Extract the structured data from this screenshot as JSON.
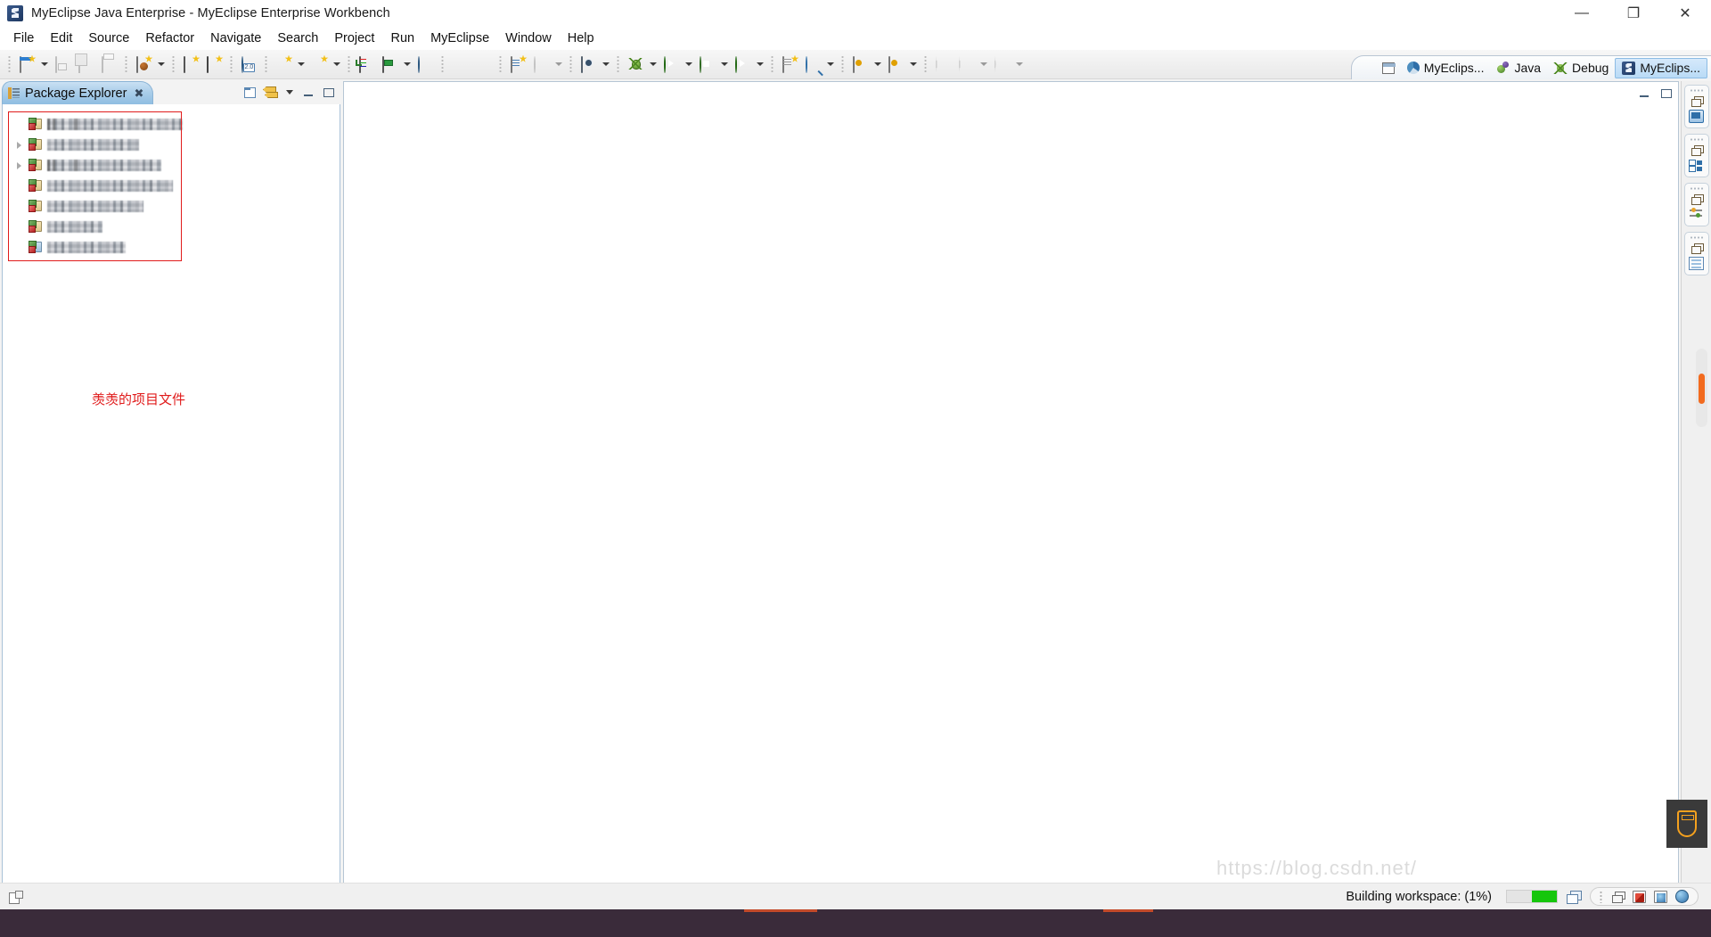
{
  "window": {
    "title": "MyEclipse Java Enterprise - MyEclipse Enterprise Workbench",
    "app_icon": "myeclipse-logo-icon",
    "minimize_label": "—",
    "maximize_label": "❐",
    "close_label": "✕"
  },
  "menubar": {
    "items": [
      {
        "label": "File",
        "name": "menu-file"
      },
      {
        "label": "Edit",
        "name": "menu-edit"
      },
      {
        "label": "Source",
        "name": "menu-source"
      },
      {
        "label": "Refactor",
        "name": "menu-refactor"
      },
      {
        "label": "Navigate",
        "name": "menu-navigate"
      },
      {
        "label": "Search",
        "name": "menu-search"
      },
      {
        "label": "Project",
        "name": "menu-project"
      },
      {
        "label": "Run",
        "name": "menu-run"
      },
      {
        "label": "MyEclipse",
        "name": "menu-myeclipse"
      },
      {
        "label": "Window",
        "name": "menu-window"
      },
      {
        "label": "Help",
        "name": "menu-help"
      }
    ]
  },
  "toolbar": {
    "groups": [
      {
        "name": "file-group",
        "buttons": [
          {
            "icon": "new-wizard-icon",
            "dropdown": true,
            "enabled": true
          },
          {
            "icon": "save-icon",
            "dropdown": false,
            "enabled": false
          },
          {
            "icon": "save-all-icon",
            "dropdown": false,
            "enabled": false
          },
          {
            "icon": "print-icon",
            "dropdown": false,
            "enabled": false
          }
        ]
      },
      {
        "name": "java-group",
        "buttons": [
          {
            "icon": "new-java-class-icon",
            "dropdown": true,
            "enabled": true
          }
        ]
      },
      {
        "name": "package-group",
        "buttons": [
          {
            "icon": "open-type-icon",
            "dropdown": false,
            "enabled": true
          },
          {
            "icon": "open-package-icon",
            "dropdown": false,
            "enabled": true
          }
        ]
      },
      {
        "name": "web-group",
        "buttons": [
          {
            "icon": "web-20-icon",
            "dropdown": false,
            "enabled": true
          }
        ]
      },
      {
        "name": "deploy-group",
        "buttons": [
          {
            "icon": "deploy-icon",
            "dropdown": true,
            "enabled": true
          },
          {
            "icon": "web-deploy-icon",
            "dropdown": true,
            "enabled": true
          }
        ]
      },
      {
        "name": "server-group",
        "buttons": [
          {
            "icon": "db-explorer-icon",
            "dropdown": false,
            "enabled": true
          },
          {
            "icon": "server-icon",
            "dropdown": true,
            "enabled": true
          },
          {
            "icon": "globe-icon",
            "dropdown": false,
            "enabled": true
          }
        ]
      },
      {
        "name": "upload-group",
        "buttons": [
          {
            "icon": "upload-icon",
            "dropdown": false,
            "enabled": false
          },
          {
            "icon": "download-icon",
            "dropdown": false,
            "enabled": false
          }
        ]
      },
      {
        "name": "annotate-group",
        "buttons": [
          {
            "icon": "edit-annotation-icon",
            "dropdown": false,
            "enabled": true
          },
          {
            "icon": "web-browser-icon",
            "dropdown": true,
            "enabled": false
          }
        ]
      },
      {
        "name": "snapshot-group",
        "buttons": [
          {
            "icon": "snapshot-icon",
            "dropdown": true,
            "enabled": true
          }
        ]
      },
      {
        "name": "debug-run-group",
        "buttons": [
          {
            "icon": "debug-icon",
            "dropdown": true,
            "enabled": true
          },
          {
            "icon": "run-icon",
            "dropdown": true,
            "enabled": true
          },
          {
            "icon": "run-external-icon",
            "dropdown": true,
            "enabled": true
          },
          {
            "icon": "run-validate-icon",
            "dropdown": true,
            "enabled": true
          }
        ]
      },
      {
        "name": "search-group",
        "buttons": [
          {
            "icon": "open-task-icon",
            "dropdown": false,
            "enabled": true
          },
          {
            "icon": "search-icon",
            "dropdown": true,
            "enabled": true
          }
        ]
      },
      {
        "name": "marker-group",
        "buttons": [
          {
            "icon": "next-annotation-icon",
            "dropdown": true,
            "enabled": true
          },
          {
            "icon": "prev-annotation-icon",
            "dropdown": true,
            "enabled": true
          }
        ]
      },
      {
        "name": "nav-history-group",
        "buttons": [
          {
            "icon": "back-icon",
            "dropdown": false,
            "enabled": false
          },
          {
            "icon": "backward-icon",
            "dropdown": true,
            "enabled": false
          },
          {
            "icon": "forward-icon",
            "dropdown": true,
            "enabled": false
          }
        ]
      }
    ]
  },
  "perspective_bar": {
    "open_perspective_icon": "open-perspective-icon",
    "items": [
      {
        "label": "MyEclips...",
        "icon": "myeclipse-java-ee-icon",
        "active": false,
        "name": "perspective-myeclipse-javaee"
      },
      {
        "label": "Java",
        "icon": "java-perspective-icon",
        "active": false,
        "name": "perspective-java"
      },
      {
        "label": "Debug",
        "icon": "debug-perspective-icon",
        "active": false,
        "name": "perspective-debug"
      },
      {
        "label": "MyEclips...",
        "icon": "myeclipse-perspective-icon",
        "active": true,
        "name": "perspective-myeclipse"
      }
    ]
  },
  "package_explorer": {
    "title": "Package Explorer",
    "tab_icon": "package-explorer-icon",
    "close_icon": "close-icon",
    "toolbar": [
      {
        "icon": "collapse-all-icon",
        "name": "collapse-all-button"
      },
      {
        "icon": "link-with-editor-icon",
        "name": "link-with-editor-button"
      },
      {
        "icon": "view-menu-icon",
        "name": "view-menu-button"
      },
      {
        "icon": "minimize-icon",
        "name": "minimize-view-button"
      },
      {
        "icon": "maximize-icon",
        "name": "maximize-view-button"
      }
    ],
    "projects": [
      {
        "label": "",
        "redacted": true,
        "selected": true,
        "expandable": false,
        "icon": "java-web-project-icon"
      },
      {
        "label": "",
        "redacted": true,
        "selected": false,
        "expandable": true,
        "icon": "java-web-project-icon"
      },
      {
        "label": "",
        "redacted": true,
        "selected": false,
        "expandable": true,
        "icon": "java-web-project-icon"
      },
      {
        "label": "",
        "redacted": true,
        "selected": false,
        "expandable": false,
        "icon": "java-web-project-icon"
      },
      {
        "label": "",
        "redacted": true,
        "selected": false,
        "expandable": false,
        "icon": "java-project-icon"
      },
      {
        "label": "",
        "redacted": true,
        "selected": false,
        "expandable": false,
        "icon": "java-project-icon"
      },
      {
        "label": "",
        "redacted": true,
        "selected": false,
        "expandable": false,
        "icon": "java-web-project-icon"
      }
    ],
    "annotation": {
      "text": "羡羡的项目文件",
      "color": "#e01b1b",
      "highlight_box_color": "#e01b1b"
    }
  },
  "editor_area": {
    "empty": true,
    "minimize_icon": "minimize-icon",
    "maximize_icon": "maximize-icon"
  },
  "right_stack_bar": {
    "stacks": [
      {
        "restore_icon": "restore-icon",
        "view_icon": "console-view-icon",
        "name": "fastview-console"
      },
      {
        "restore_icon": "restore-icon",
        "view_icon": "outline-view-icon",
        "name": "fastview-outline"
      },
      {
        "restore_icon": "restore-icon",
        "view_icon": "properties-view-icon",
        "name": "fastview-properties"
      },
      {
        "restore_icon": "restore-icon",
        "view_icon": "servers-view-icon",
        "name": "fastview-servers"
      }
    ],
    "scrollbar": {
      "name": "vertical-scrollbar",
      "thumb_color": "#f26b1f"
    },
    "usb_widget_icon": "usb-device-icon"
  },
  "status_bar": {
    "left_icon": "editor-state-icon",
    "build_text": "Building workspace: (1%)",
    "progress_percent": 1,
    "progress_color": "#16c60c",
    "jobs_icon": "show-jobs-icon",
    "tray_icons": [
      {
        "icon": "restore-trim-icon",
        "name": "restore-trim-button"
      },
      {
        "icon": "problems-trim-icon",
        "name": "problems-trim-button"
      },
      {
        "icon": "tasks-trim-icon",
        "name": "tasks-trim-button"
      },
      {
        "icon": "browser-trim-icon",
        "name": "browser-trim-button"
      }
    ],
    "watermark": "https://blog.csdn.net/"
  },
  "taskbar": {
    "background": "#3a2b3a"
  }
}
